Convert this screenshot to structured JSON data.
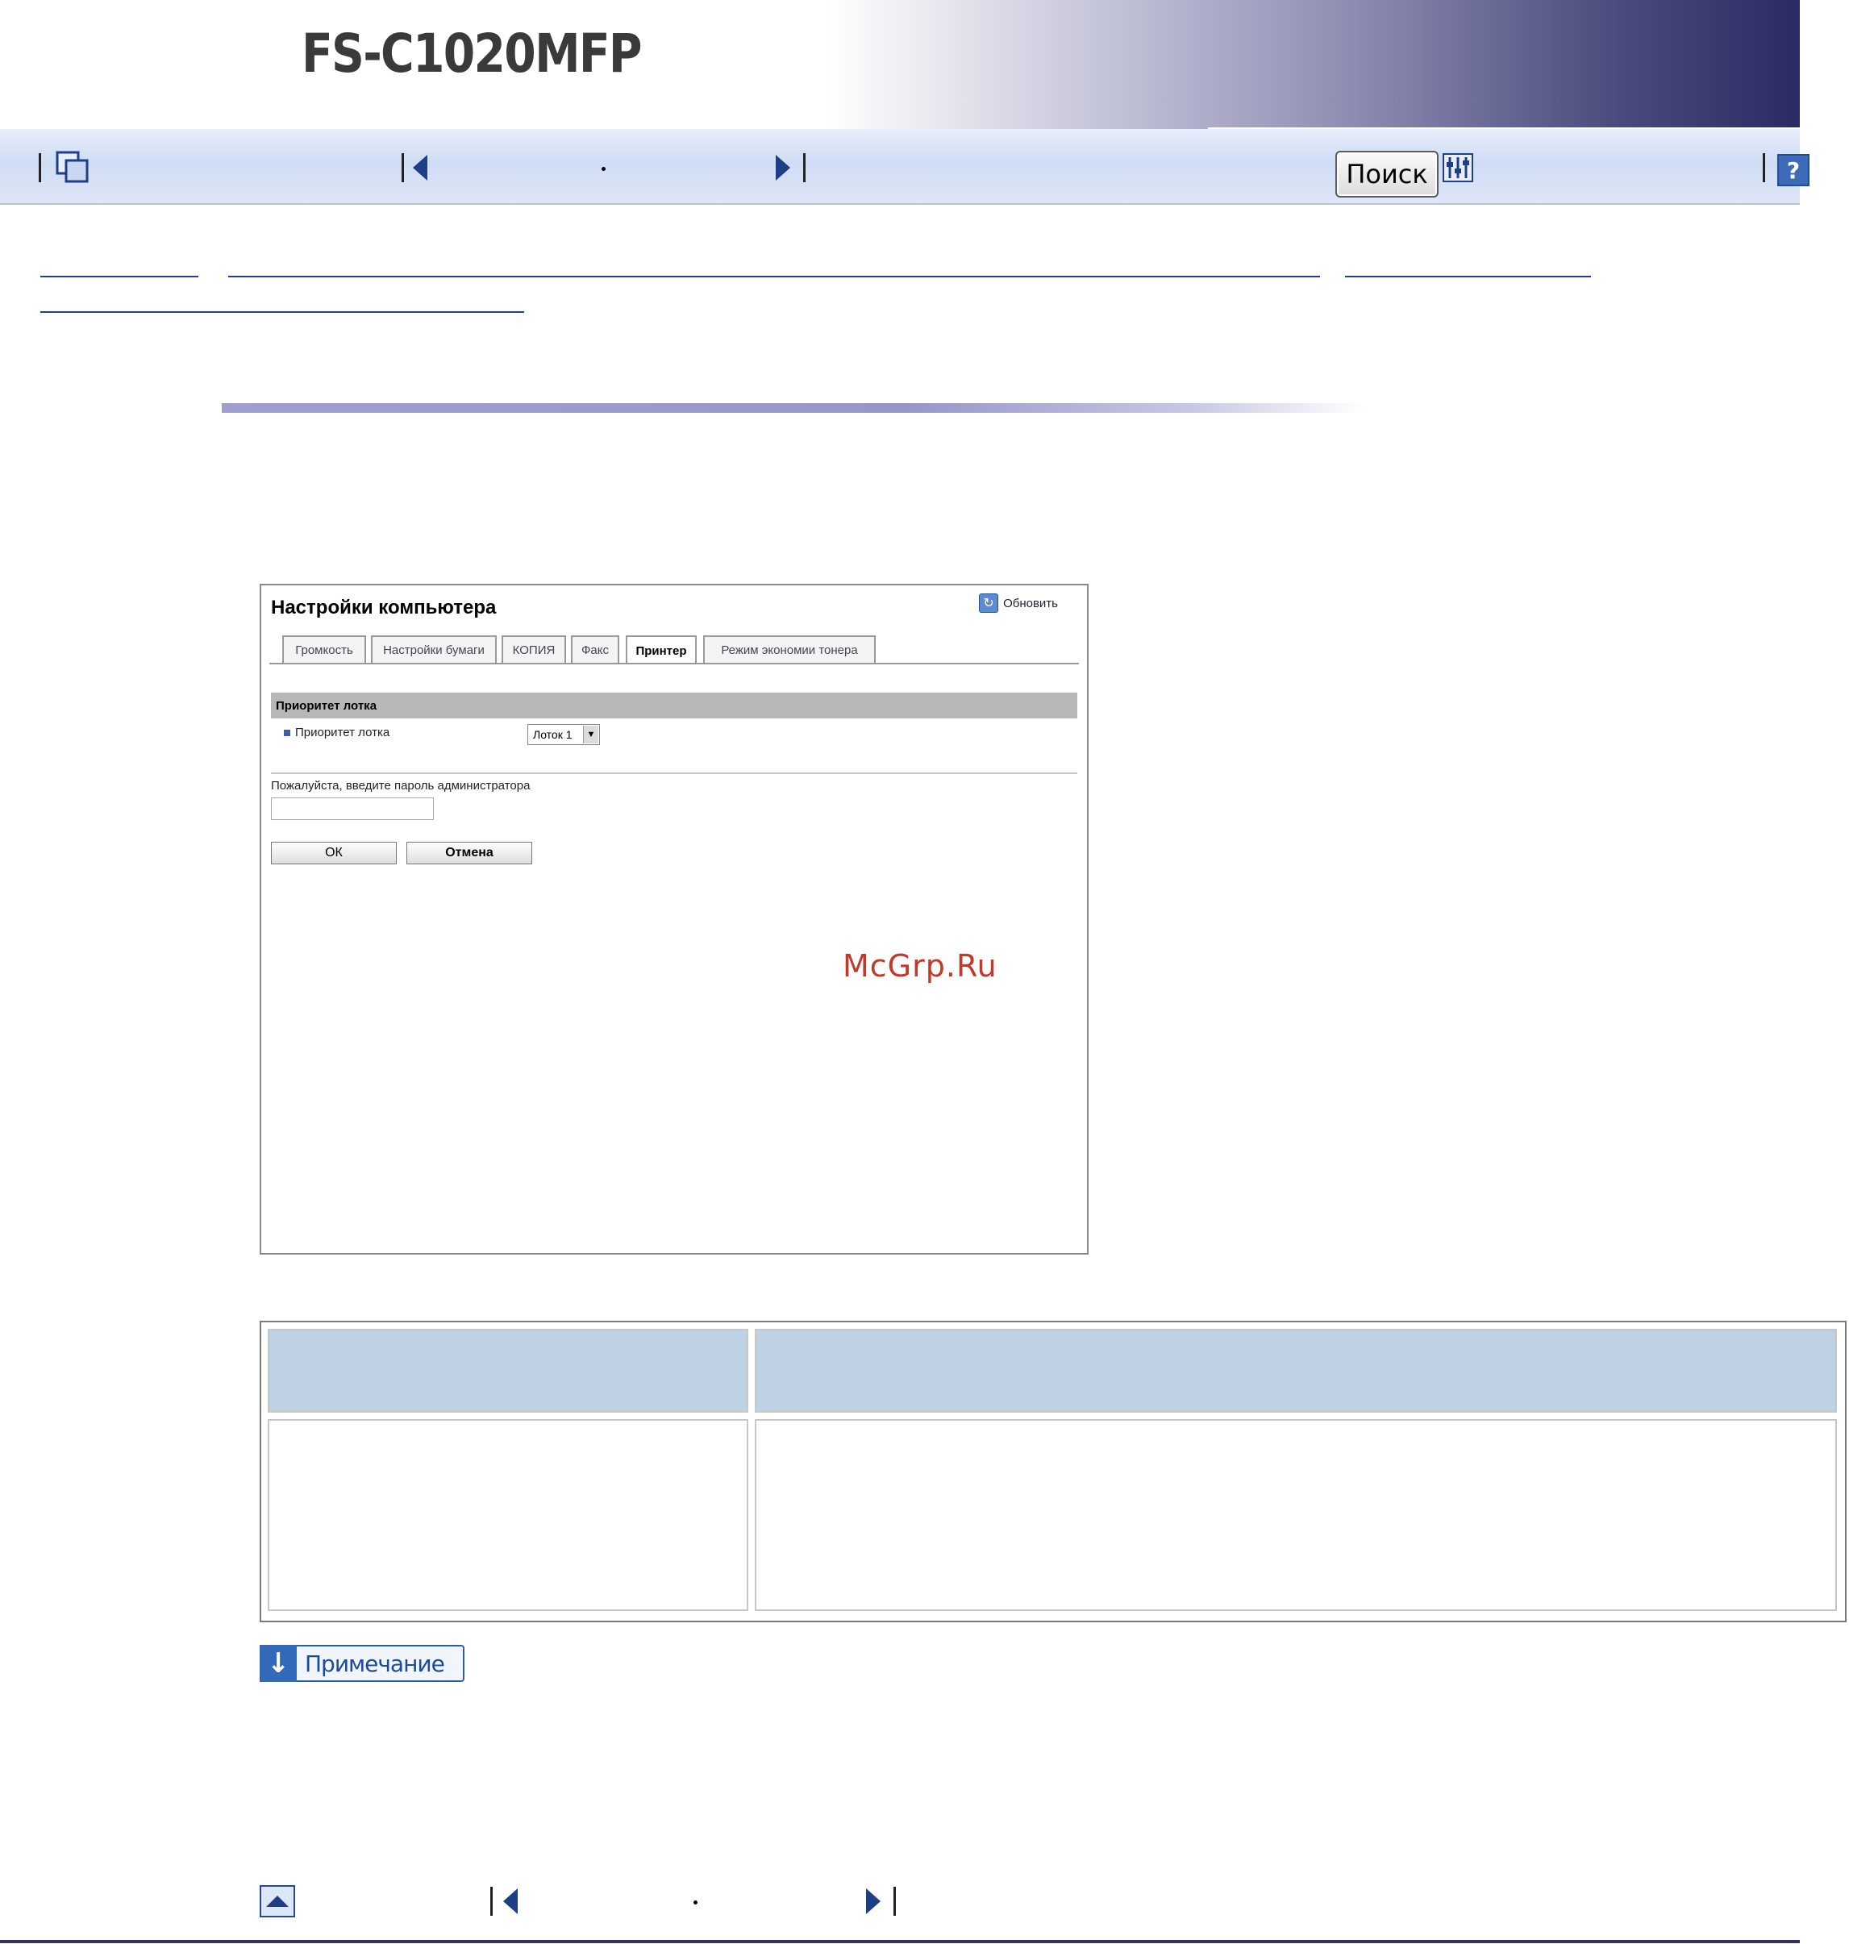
{
  "header": {
    "product": "FS-C1020MFP"
  },
  "toolbar": {
    "search_label": "Поиск",
    "page_indicator": "·"
  },
  "screenshot": {
    "title": "Настройки компьютера",
    "refresh_label": "Обновить",
    "tabs": [
      "Громкость",
      "Настройки бумаги",
      "КОПИЯ",
      "Факс",
      "Принтер",
      "Режим экономии тонера"
    ],
    "active_tab": "Принтер",
    "section_header": "Приоритет лотка",
    "setting_label": "Приоритет лотка",
    "setting_value": "Лоток 1",
    "password_label": "Пожалуйста, введите пароль администратора",
    "ok_label": "ОК",
    "cancel_label": "Отмена"
  },
  "watermark": "McGrp.Ru",
  "note": {
    "label": "Примечание"
  },
  "bottom_nav": {
    "page_indicator": "·"
  }
}
